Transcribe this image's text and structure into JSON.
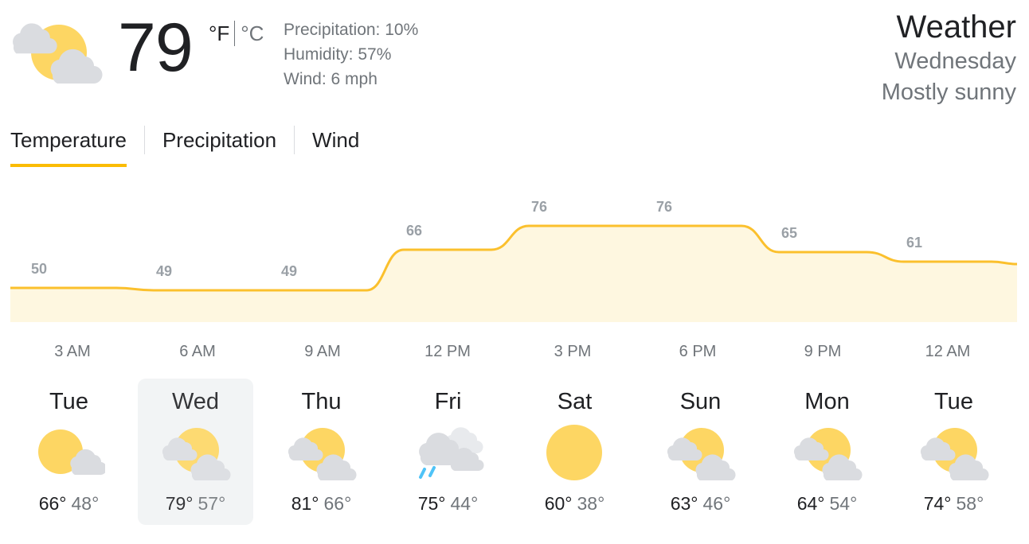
{
  "current": {
    "temperature": "79",
    "unit_f": "°F",
    "unit_c": "°C",
    "icon": "partly-cloudy-icon",
    "precipitation": "Precipitation: 10%",
    "humidity": "Humidity: 57%",
    "wind": "Wind: 6 mph"
  },
  "header": {
    "title": "Weather",
    "day": "Wednesday",
    "condition": "Mostly sunny"
  },
  "tabs": [
    {
      "label": "Temperature",
      "active": true
    },
    {
      "label": "Precipitation",
      "active": false
    },
    {
      "label": "Wind",
      "active": false
    }
  ],
  "colors": {
    "accent": "#fbbc04",
    "line": "#fbc02d",
    "fill": "#fef7e0",
    "sun": "#fdd663",
    "cloud": "#dadce0",
    "rain": "#4fc3f7"
  },
  "chart_data": {
    "type": "area",
    "x": [
      "3 AM",
      "6 AM",
      "9 AM",
      "12 PM",
      "3 PM",
      "6 PM",
      "9 PM",
      "12 AM"
    ],
    "values": [
      50,
      49,
      49,
      66,
      76,
      76,
      65,
      61
    ],
    "unit": "°F",
    "grid": false
  },
  "days": [
    {
      "name": "Tue",
      "hi": "66°",
      "lo": "48°",
      "icon": "sun-cloud-icon",
      "selected": false
    },
    {
      "name": "Wed",
      "hi": "79°",
      "lo": "57°",
      "icon": "partly-cloudy-icon",
      "selected": true
    },
    {
      "name": "Thu",
      "hi": "81°",
      "lo": "66°",
      "icon": "partly-cloudy-icon",
      "selected": false
    },
    {
      "name": "Fri",
      "hi": "75°",
      "lo": "44°",
      "icon": "rain-icon",
      "selected": false
    },
    {
      "name": "Sat",
      "hi": "60°",
      "lo": "38°",
      "icon": "sunny-icon",
      "selected": false
    },
    {
      "name": "Sun",
      "hi": "63°",
      "lo": "46°",
      "icon": "partly-cloudy-icon",
      "selected": false
    },
    {
      "name": "Mon",
      "hi": "64°",
      "lo": "54°",
      "icon": "partly-cloudy-icon",
      "selected": false
    },
    {
      "name": "Tue",
      "hi": "74°",
      "lo": "58°",
      "icon": "partly-cloudy-icon",
      "selected": false
    }
  ]
}
